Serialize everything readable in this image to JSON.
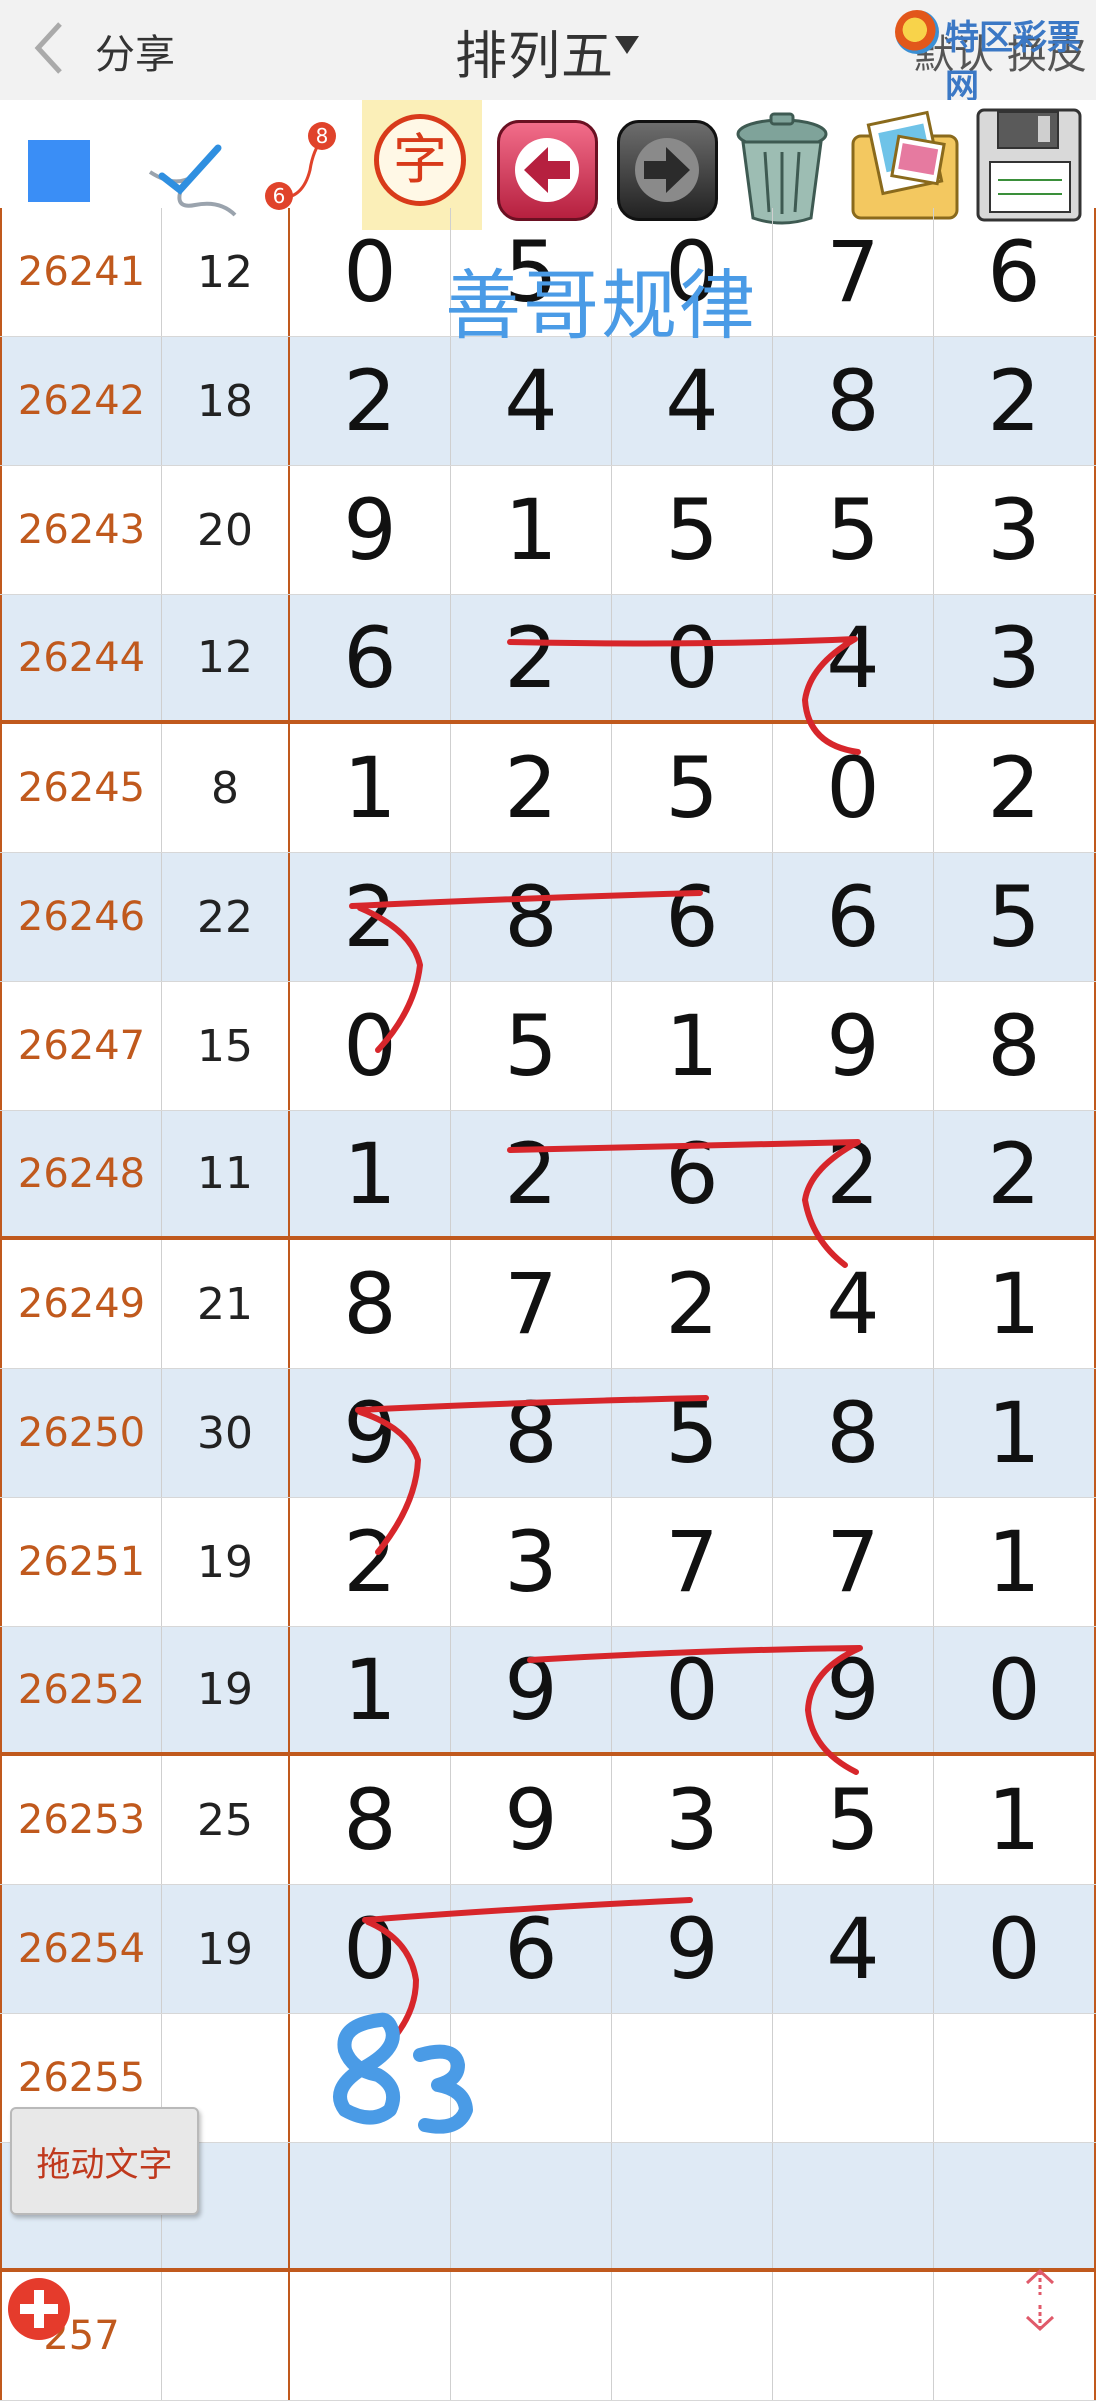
{
  "header": {
    "share_label": "分享",
    "title": "排列五",
    "default_label": "默认 换皮",
    "watermark": "特区彩票网"
  },
  "toolbar": {
    "color_numbers": [
      "8",
      "6"
    ],
    "char_tool": "字"
  },
  "overlay_title": "善哥规律",
  "handwritten_note": "83",
  "drag_button": "拖动文字",
  "rows": [
    {
      "issue": "26241",
      "sum": "12",
      "digits": [
        "0",
        "5",
        "0",
        "7",
        "6"
      ]
    },
    {
      "issue": "26242",
      "sum": "18",
      "digits": [
        "2",
        "4",
        "4",
        "8",
        "2"
      ]
    },
    {
      "issue": "26243",
      "sum": "20",
      "digits": [
        "9",
        "1",
        "5",
        "5",
        "3"
      ]
    },
    {
      "issue": "26244",
      "sum": "12",
      "digits": [
        "6",
        "2",
        "0",
        "4",
        "3"
      ]
    },
    {
      "issue": "26245",
      "sum": "8",
      "digits": [
        "1",
        "2",
        "5",
        "0",
        "2"
      ]
    },
    {
      "issue": "26246",
      "sum": "22",
      "digits": [
        "2",
        "8",
        "6",
        "6",
        "5"
      ]
    },
    {
      "issue": "26247",
      "sum": "15",
      "digits": [
        "0",
        "5",
        "1",
        "9",
        "8"
      ]
    },
    {
      "issue": "26248",
      "sum": "11",
      "digits": [
        "1",
        "2",
        "6",
        "2",
        "2"
      ]
    },
    {
      "issue": "26249",
      "sum": "21",
      "digits": [
        "8",
        "7",
        "2",
        "4",
        "1"
      ]
    },
    {
      "issue": "26250",
      "sum": "30",
      "digits": [
        "9",
        "8",
        "5",
        "8",
        "1"
      ]
    },
    {
      "issue": "26251",
      "sum": "19",
      "digits": [
        "2",
        "3",
        "7",
        "7",
        "1"
      ]
    },
    {
      "issue": "26252",
      "sum": "19",
      "digits": [
        "1",
        "9",
        "0",
        "9",
        "0"
      ]
    },
    {
      "issue": "26253",
      "sum": "25",
      "digits": [
        "8",
        "9",
        "3",
        "5",
        "1"
      ]
    },
    {
      "issue": "26254",
      "sum": "19",
      "digits": [
        "0",
        "6",
        "9",
        "4",
        "0"
      ]
    },
    {
      "issue": "26255",
      "sum": "",
      "digits": [
        "",
        "",
        "",
        "",
        ""
      ]
    },
    {
      "issue": "",
      "sum": "",
      "digits": [
        "",
        "",
        "",
        "",
        ""
      ]
    },
    {
      "issue": "257",
      "sum": "",
      "digits": [
        "",
        "",
        "",
        "",
        ""
      ]
    }
  ],
  "colors": {
    "accent_orange": "#c0591d",
    "row_shade": "#dfeaf5",
    "ink_red": "#d7262b",
    "ink_blue": "#4a9be6"
  }
}
